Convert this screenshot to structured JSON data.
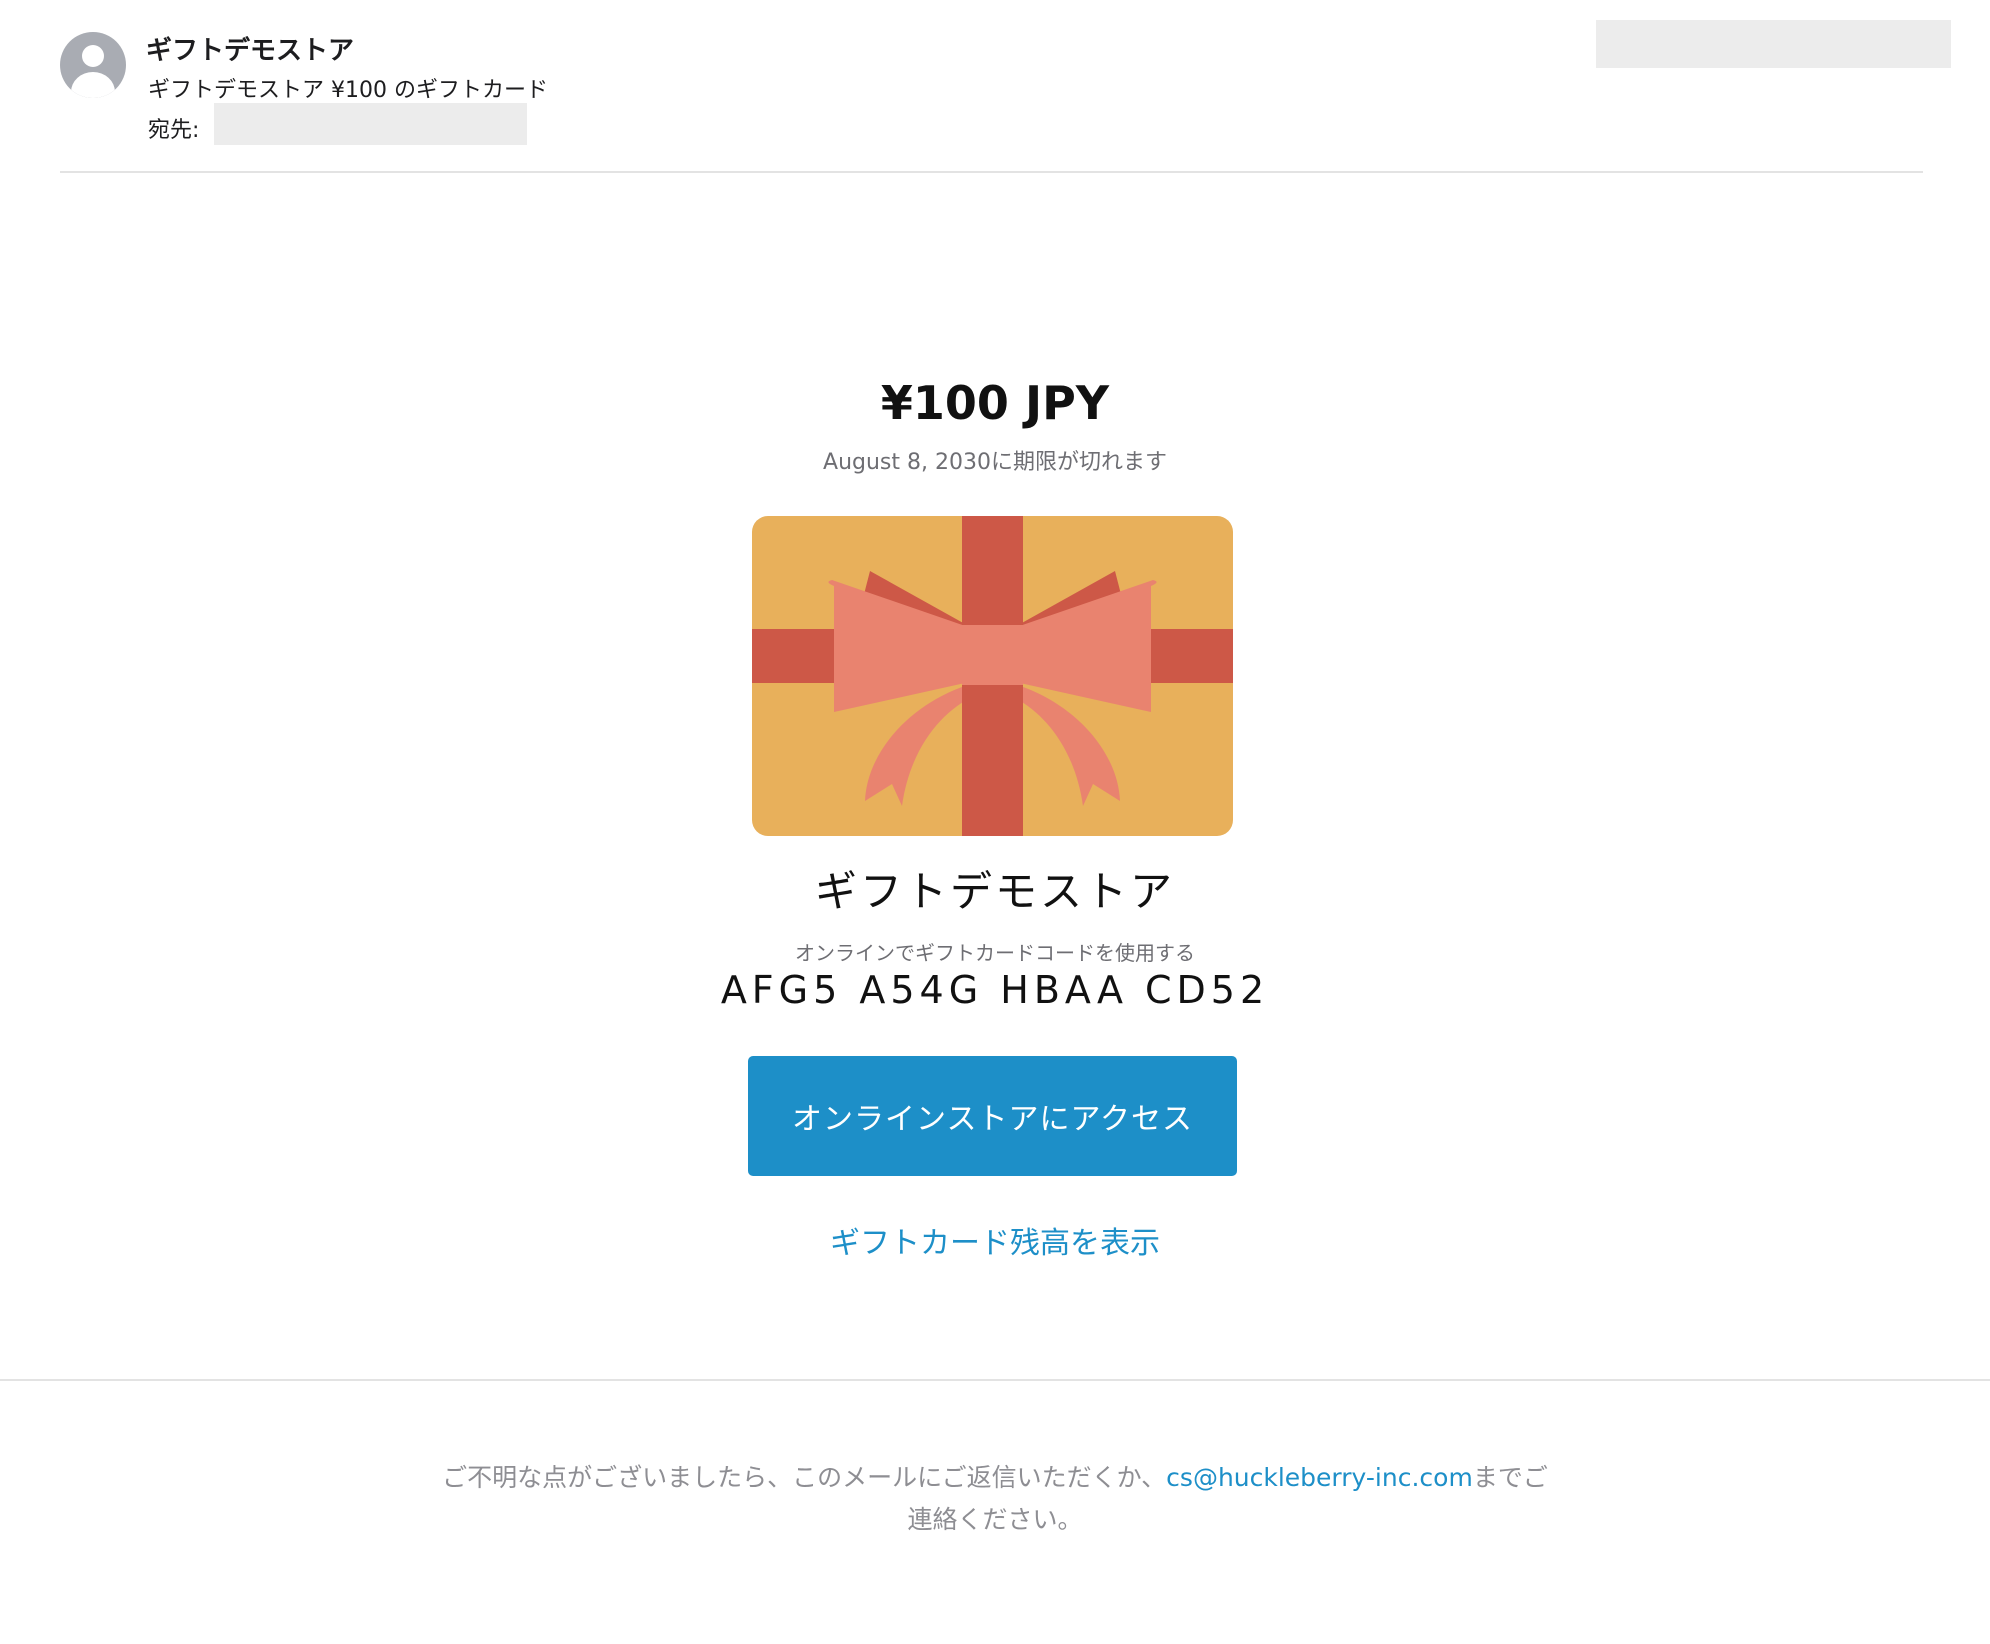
{
  "header": {
    "sender": "ギフトデモストア",
    "subject": "ギフトデモストア ¥100 のギフトカード",
    "to_label": "宛先:"
  },
  "card": {
    "amount": "¥100 JPY",
    "expiry": "August 8, 2030に期限が切れます",
    "image_icon": "gift-card-ribbon-image",
    "colors": {
      "card": "#e8b05b",
      "ribbon": "#cd5847",
      "bow": "#e9836f"
    },
    "store_name": "ギフトデモストア",
    "code_label": "オンラインでギフトカードコードを使用する",
    "code_value": "AFG5 A54G HBAA CD52",
    "cta_label": "オンラインストアにアクセス",
    "balance_link": "ギフトカード残高を表示"
  },
  "footer": {
    "text_before": "ご不明な点がございましたら、このメールにご返信いただくか、",
    "email": "cs@huckleberry-inc.com",
    "text_after": "までご連絡ください。"
  },
  "colors": {
    "accent": "#1d8fc8",
    "secondary_text": "#6e6e73",
    "redaction": "#ececec"
  }
}
